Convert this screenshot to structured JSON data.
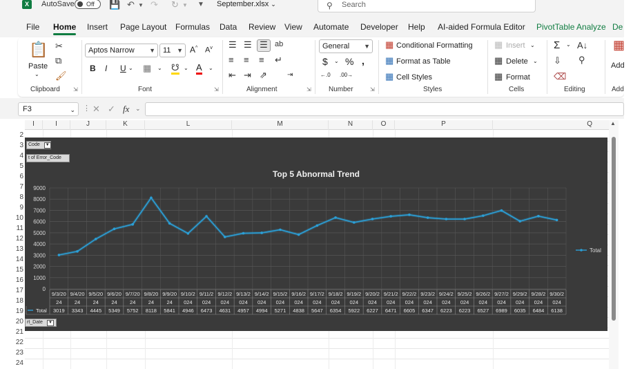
{
  "titlebar": {
    "app_icon": "excel-icon",
    "autosave_label": "AutoSave",
    "autosave_state": "Off",
    "filename": "September.xlsx",
    "search_placeholder": "Search"
  },
  "menu": {
    "tabs": [
      "File",
      "Home",
      "Insert",
      "Page Layout",
      "Formulas",
      "Data",
      "Review",
      "View",
      "Automate",
      "Developer",
      "Help",
      "AI-aided Formula Editor",
      "PivotTable Analyze",
      "De"
    ],
    "active": "Home"
  },
  "ribbon": {
    "clipboard": {
      "paste": "Paste",
      "label": "Clipboard"
    },
    "font": {
      "name": "Aptos Narrow",
      "size": "11",
      "label": "Font",
      "bold": "B",
      "italic": "I",
      "underline": "U"
    },
    "alignment": {
      "label": "Alignment"
    },
    "number": {
      "format": "General",
      "label": "Number",
      "currency": "$",
      "percent": "%"
    },
    "styles": {
      "conditional": "Conditional Formatting",
      "format_table": "Format as Table",
      "cell_styles": "Cell Styles",
      "label": "Styles"
    },
    "cells": {
      "insert": "Insert",
      "delete": "Delete",
      "format": "Format",
      "label": "Cells"
    },
    "editing": {
      "label": "Editing",
      "sum": "Σ"
    },
    "addins": {
      "add": "Add",
      "label": "Add"
    }
  },
  "formula_bar": {
    "name_box": "F3",
    "fx": "fx"
  },
  "grid": {
    "columns": [
      "I",
      "I",
      "J",
      "K",
      "L",
      "M",
      "N",
      "O",
      "P",
      "Q"
    ],
    "rows": [
      "2",
      "3",
      "4",
      "5",
      "6",
      "7",
      "8",
      "9",
      "10",
      "11",
      "12",
      "13",
      "14",
      "15",
      "16",
      "17",
      "18",
      "19",
      "20",
      "21",
      "22",
      "23",
      "24"
    ]
  },
  "pivot": {
    "filter_button": "Code",
    "values_button": "t of Error_Code",
    "axis_button": "rt_Date"
  },
  "chart_data": {
    "type": "line",
    "title": "Top 5 Abnormal Trend",
    "categories": [
      "9/3/2024",
      "9/4/2024",
      "9/5/2024",
      "9/6/2024",
      "9/7/2024",
      "9/8/2024",
      "9/9/2024",
      "9/10/2024",
      "9/11/2024",
      "9/12/2024",
      "9/13/2024",
      "9/14/2024",
      "9/15/2024",
      "9/16/2024",
      "9/17/2024",
      "9/18/2024",
      "9/19/2024",
      "9/20/2024",
      "9/21/2024",
      "9/22/2024",
      "9/23/2024",
      "9/24/2024",
      "9/25/2024",
      "9/26/2024",
      "9/27/2024",
      "9/29/2024",
      "9/28/2024",
      "9/30/2024"
    ],
    "category_line1": [
      "9/3/20",
      "9/4/20",
      "9/5/20",
      "9/6/20",
      "9/7/20",
      "9/8/20",
      "9/9/20",
      "9/10/2",
      "9/11/2",
      "9/12/2",
      "9/13/2",
      "9/14/2",
      "9/15/2",
      "9/16/2",
      "9/17/2",
      "9/18/2",
      "9/19/2",
      "9/20/2",
      "9/21/2",
      "9/22/2",
      "9/23/2",
      "9/24/2",
      "9/25/2",
      "9/26/2",
      "9/27/2",
      "9/29/2",
      "9/28/2",
      "9/30/2"
    ],
    "category_line2": [
      "24",
      "24",
      "24",
      "24",
      "24",
      "24",
      "24",
      "024",
      "024",
      "024",
      "024",
      "024",
      "024",
      "024",
      "024",
      "024",
      "024",
      "024",
      "024",
      "024",
      "024",
      "024",
      "024",
      "024",
      "024",
      "024",
      "024",
      "024"
    ],
    "series": [
      {
        "name": "Total",
        "values": [
          3019,
          3343,
          4445,
          5349,
          5752,
          8118,
          5841,
          4946,
          6473,
          4631,
          4957,
          4994,
          5271,
          4838,
          5647,
          6354,
          5922,
          6227,
          6471,
          6605,
          6347,
          6223,
          6223,
          6527,
          6989,
          6035,
          6484,
          6138
        ]
      }
    ],
    "ylim": [
      0,
      9000
    ],
    "yticks": [
      "0",
      "1000",
      "2000",
      "3000",
      "4000",
      "5000",
      "6000",
      "7000",
      "8000",
      "9000"
    ],
    "legend": "Total",
    "legend_position": "right",
    "data_table_label": "Total",
    "colors": {
      "line": "#2b9fd6",
      "background": "#3a3a3a",
      "grid": "#5a5a5a"
    }
  }
}
